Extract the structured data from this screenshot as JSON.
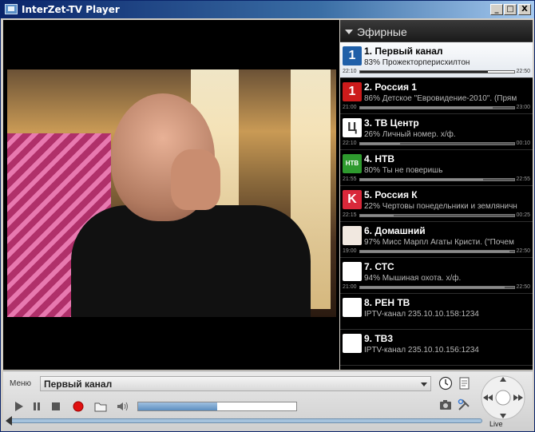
{
  "window": {
    "title": "InterZet-TV Player"
  },
  "title_buttons": {
    "minimize": "_",
    "maximize": "□",
    "close": "X"
  },
  "channel_group": {
    "title": "Эфирные"
  },
  "channels": [
    {
      "number_name": "1. Первый канал",
      "program": "83% Прожекторперисхилтон",
      "start": "22:10",
      "end": "22:50",
      "progress": 0.83,
      "selected": true,
      "logo_color": "#1f5fa8",
      "logo": "1"
    },
    {
      "number_name": "2. Россия 1",
      "program": "86% Детское \"Евровидение-2010\". (Прям",
      "start": "21:00",
      "end": "23:00",
      "progress": 0.86,
      "logo_color": "#cc1b1b",
      "logo": "1"
    },
    {
      "number_name": "3. ТВ Центр",
      "program": "26% Личный номер. х/ф.",
      "start": "22:10",
      "end": "00:10",
      "progress": 0.26,
      "logo_color": "#ffffff",
      "logo": "Ц"
    },
    {
      "number_name": "4. НТВ",
      "program": "80% Ты не поверишь",
      "start": "21:55",
      "end": "22:55",
      "progress": 0.8,
      "logo_color": "#2e9a2e",
      "logo": "НТВ"
    },
    {
      "number_name": "5. Россия К",
      "program": "22% Чертовы понедельники и земляничн",
      "start": "22:15",
      "end": "00:25",
      "progress": 0.22,
      "logo_color": "#d9283a",
      "logo": "K"
    },
    {
      "number_name": "6. Домашний",
      "program": "97% Мисс Марпл Агаты Кристи. (\"Почем",
      "start": "19:00",
      "end": "22:50",
      "progress": 0.97,
      "logo_color": "#f1e8e0",
      "logo": ""
    },
    {
      "number_name": "7. СТС",
      "program": "94% Мышиная охота. х/ф.",
      "start": "21:00",
      "end": "22:50",
      "progress": 0.94,
      "logo_color": "#ffffff",
      "logo": ""
    },
    {
      "number_name": "8. РЕН ТВ",
      "program": "IPTV-канал 235.10.10.158:1234",
      "start": "",
      "end": "",
      "progress": null,
      "logo_color": "#ffffff",
      "logo": ""
    },
    {
      "number_name": "9. ТВ3",
      "program": "IPTV-канал 235.10.10.156:1234",
      "start": "",
      "end": "",
      "progress": null,
      "logo_color": "#ffffff",
      "logo": ""
    }
  ],
  "bottom": {
    "menu_label": "Меню",
    "current_channel": "Первый канал",
    "volume_level": 0.5,
    "live_label": "Live"
  },
  "colors": {
    "accent": "#3a6ea5",
    "record": "#e01010",
    "progress_fill": "#5d8fc0"
  }
}
